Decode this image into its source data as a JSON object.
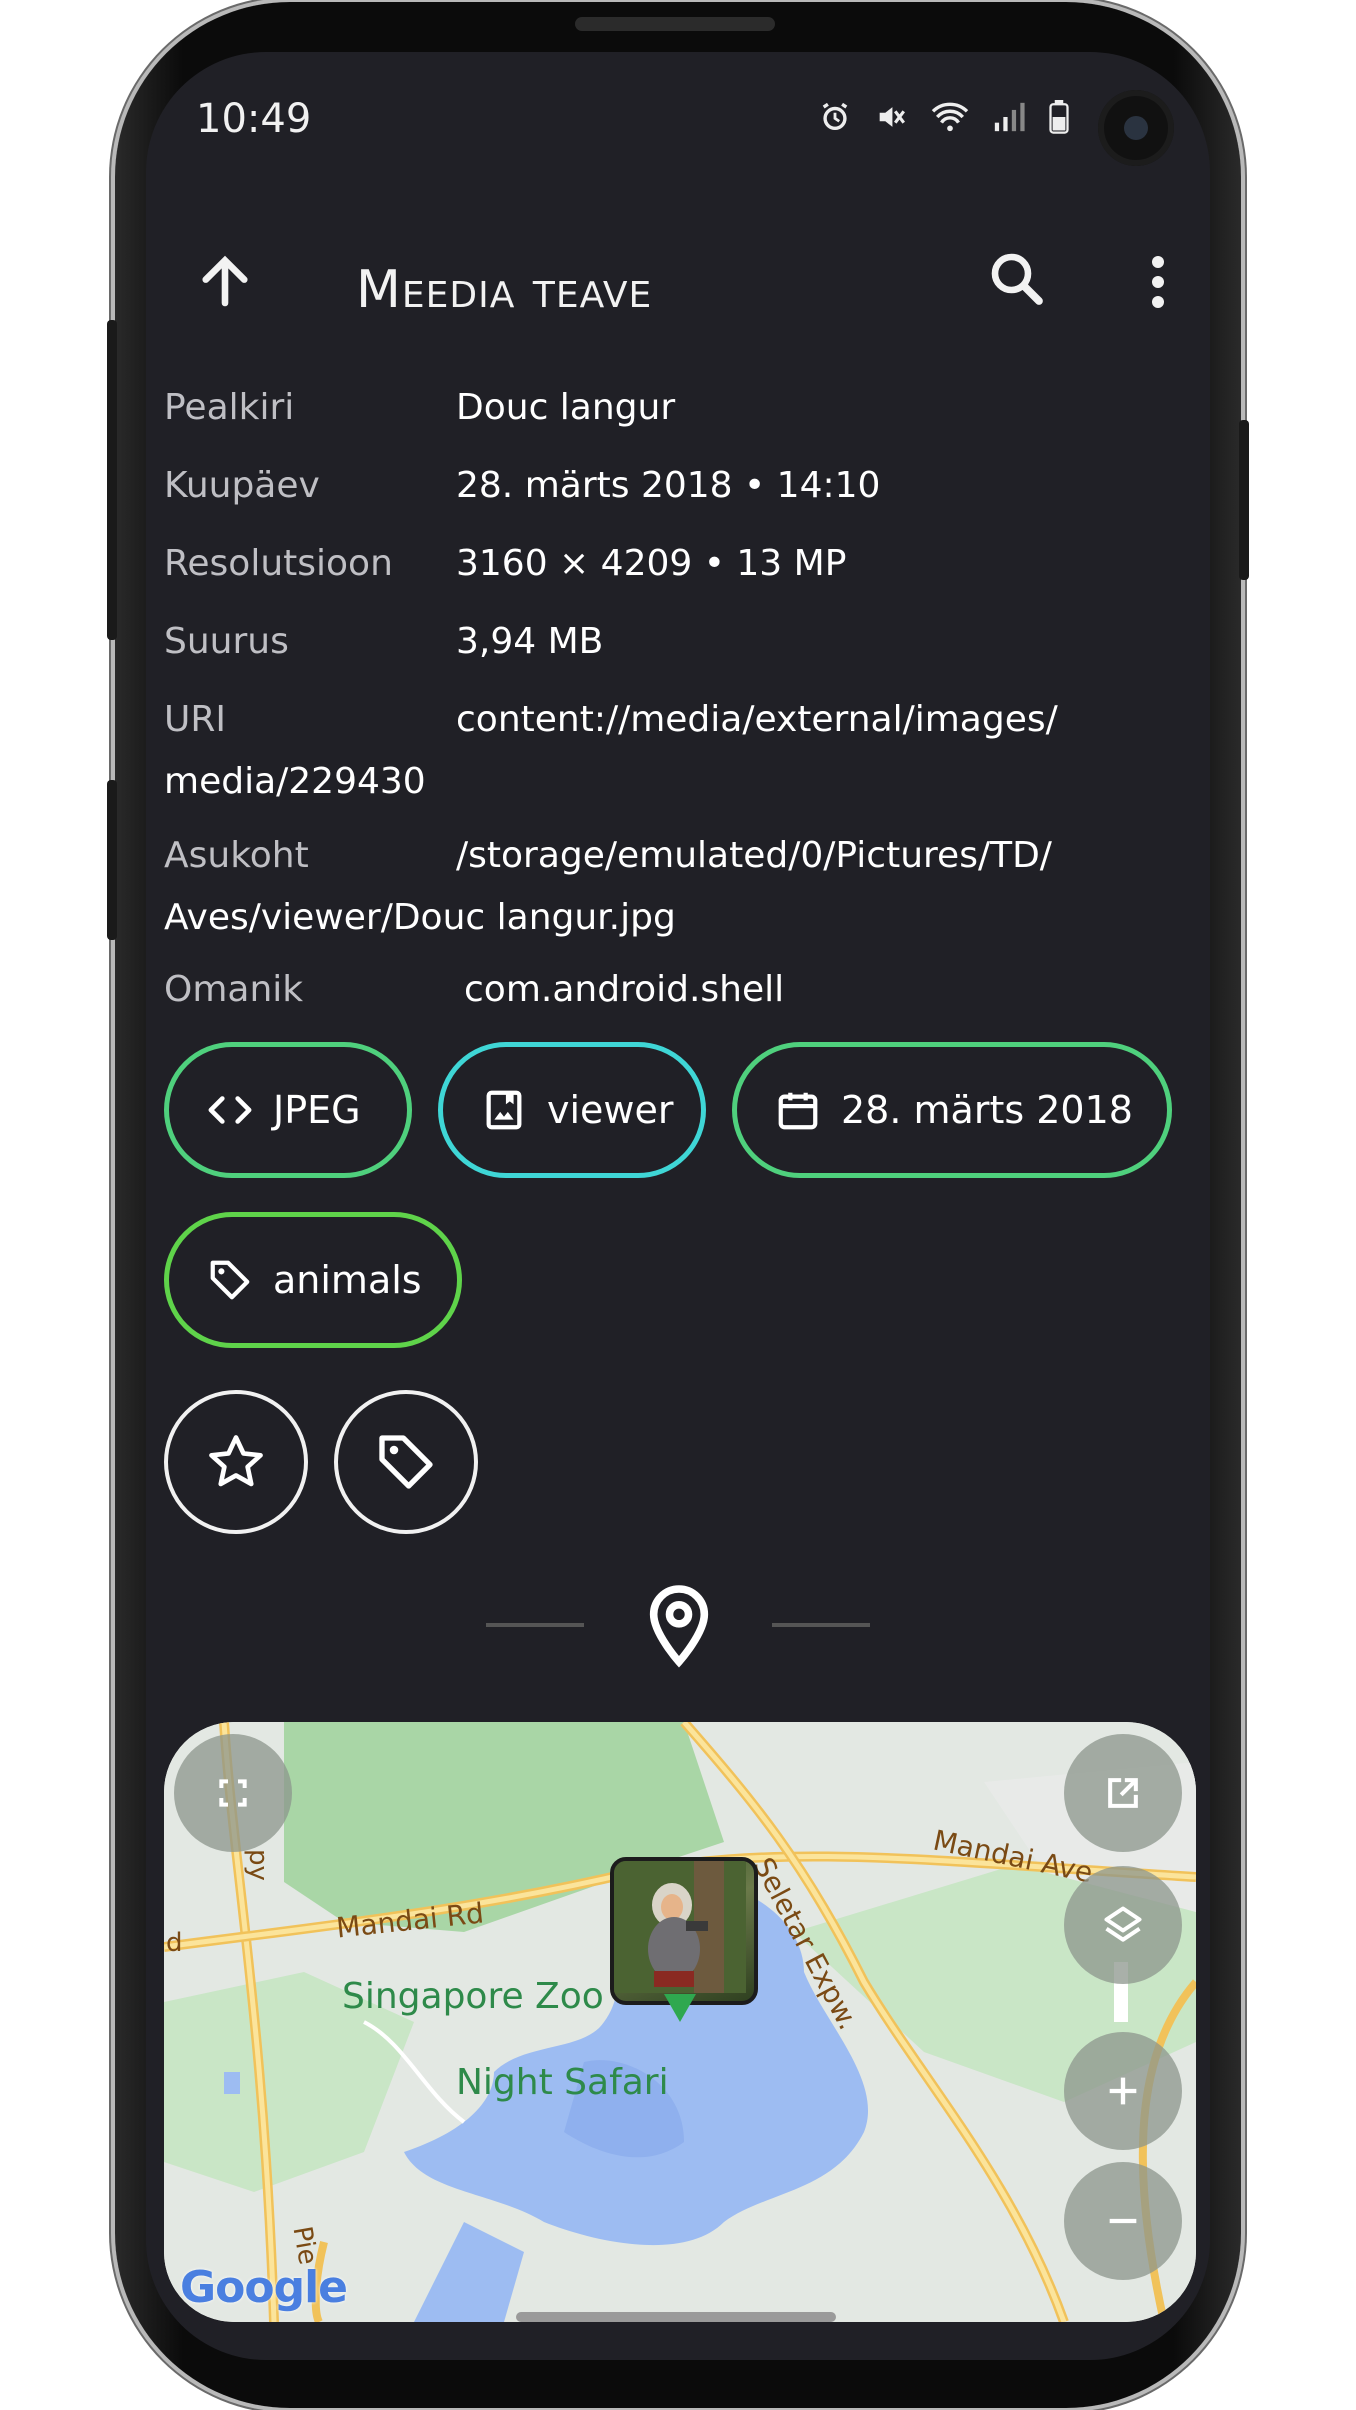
{
  "status_bar": {
    "time": "10:49"
  },
  "app_bar": {
    "title": "Meedia teave"
  },
  "info": {
    "rows": [
      {
        "key": "Pealkiri",
        "value": "Douc langur"
      },
      {
        "key": "Kuupäev",
        "value": "28. märts 2018 • 14:10"
      },
      {
        "key": "Resolutsioon",
        "value": "3160 × 4209 • 13 MP"
      },
      {
        "key": "Suurus",
        "value": "3,94 MB"
      },
      {
        "key": "URI",
        "value": "content://media/external/images/",
        "cont": "media/229430"
      },
      {
        "key": "Asukoht",
        "value": "/storage/emulated/0/Pictures/TD/",
        "cont": "Aves/viewer/Douc langur.jpg"
      },
      {
        "key": "Omanik",
        "value": "com.android.shell"
      }
    ]
  },
  "chips": [
    {
      "label": "JPEG",
      "icon": "code-icon",
      "color": "#4fd07d"
    },
    {
      "label": "viewer",
      "icon": "album-icon",
      "color": "#3fd6d6"
    },
    {
      "label": "28. märts 2018",
      "icon": "calendar-icon",
      "color": "#4fd07d"
    },
    {
      "label": "animals",
      "icon": "tag-icon",
      "color": "#5fd34a"
    }
  ],
  "map": {
    "labels": {
      "mandai_rd": "Mandai Rd",
      "singapore_zoo": "Singapore Zoo",
      "night_safari": "Night Safari",
      "seletar_expw": "Seletar Expw.",
      "mandai_ave": "Mandai Ave",
      "google": "Google",
      "pie_left": "py",
      "pie_left2": "d",
      "pie_bottom": "Pie"
    }
  }
}
